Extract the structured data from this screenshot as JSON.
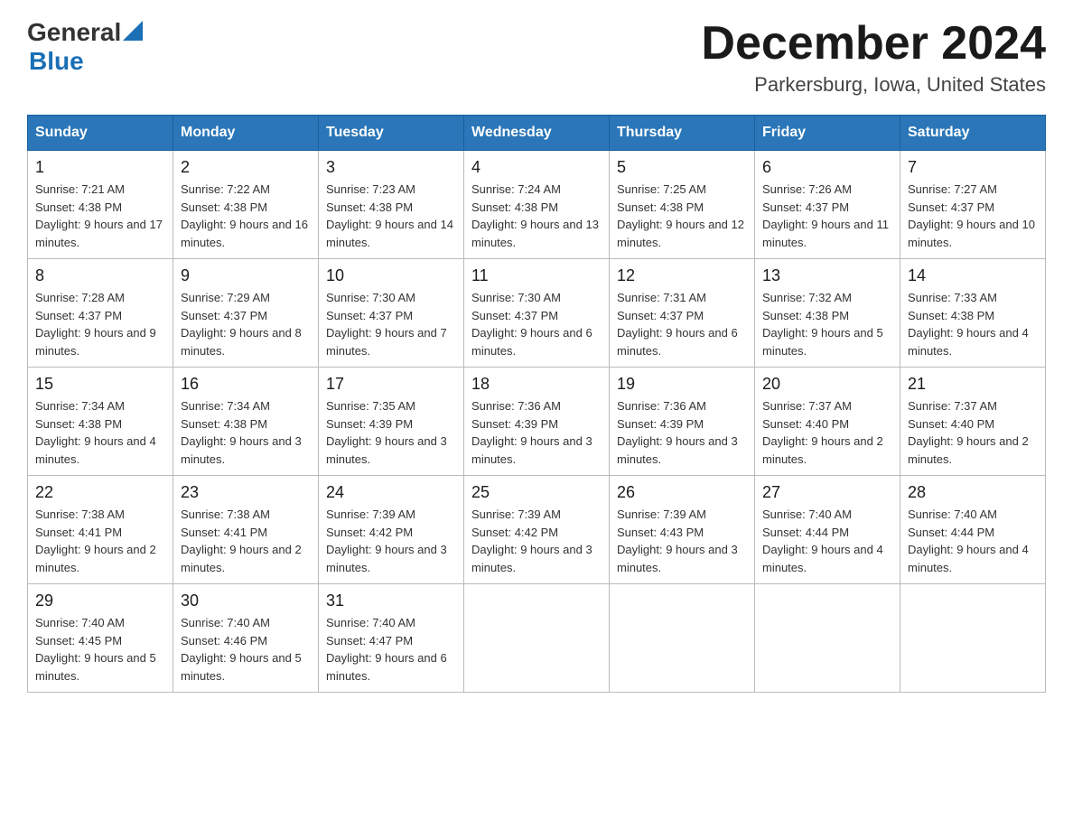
{
  "logo": {
    "general": "General",
    "blue": "Blue"
  },
  "header": {
    "month_title": "December 2024",
    "location": "Parkersburg, Iowa, United States"
  },
  "weekdays": [
    "Sunday",
    "Monday",
    "Tuesday",
    "Wednesday",
    "Thursday",
    "Friday",
    "Saturday"
  ],
  "weeks": [
    [
      {
        "day": "1",
        "sunrise": "7:21 AM",
        "sunset": "4:38 PM",
        "daylight": "9 hours and 17 minutes."
      },
      {
        "day": "2",
        "sunrise": "7:22 AM",
        "sunset": "4:38 PM",
        "daylight": "9 hours and 16 minutes."
      },
      {
        "day": "3",
        "sunrise": "7:23 AM",
        "sunset": "4:38 PM",
        "daylight": "9 hours and 14 minutes."
      },
      {
        "day": "4",
        "sunrise": "7:24 AM",
        "sunset": "4:38 PM",
        "daylight": "9 hours and 13 minutes."
      },
      {
        "day": "5",
        "sunrise": "7:25 AM",
        "sunset": "4:38 PM",
        "daylight": "9 hours and 12 minutes."
      },
      {
        "day": "6",
        "sunrise": "7:26 AM",
        "sunset": "4:37 PM",
        "daylight": "9 hours and 11 minutes."
      },
      {
        "day": "7",
        "sunrise": "7:27 AM",
        "sunset": "4:37 PM",
        "daylight": "9 hours and 10 minutes."
      }
    ],
    [
      {
        "day": "8",
        "sunrise": "7:28 AM",
        "sunset": "4:37 PM",
        "daylight": "9 hours and 9 minutes."
      },
      {
        "day": "9",
        "sunrise": "7:29 AM",
        "sunset": "4:37 PM",
        "daylight": "9 hours and 8 minutes."
      },
      {
        "day": "10",
        "sunrise": "7:30 AM",
        "sunset": "4:37 PM",
        "daylight": "9 hours and 7 minutes."
      },
      {
        "day": "11",
        "sunrise": "7:30 AM",
        "sunset": "4:37 PM",
        "daylight": "9 hours and 6 minutes."
      },
      {
        "day": "12",
        "sunrise": "7:31 AM",
        "sunset": "4:37 PM",
        "daylight": "9 hours and 6 minutes."
      },
      {
        "day": "13",
        "sunrise": "7:32 AM",
        "sunset": "4:38 PM",
        "daylight": "9 hours and 5 minutes."
      },
      {
        "day": "14",
        "sunrise": "7:33 AM",
        "sunset": "4:38 PM",
        "daylight": "9 hours and 4 minutes."
      }
    ],
    [
      {
        "day": "15",
        "sunrise": "7:34 AM",
        "sunset": "4:38 PM",
        "daylight": "9 hours and 4 minutes."
      },
      {
        "day": "16",
        "sunrise": "7:34 AM",
        "sunset": "4:38 PM",
        "daylight": "9 hours and 3 minutes."
      },
      {
        "day": "17",
        "sunrise": "7:35 AM",
        "sunset": "4:39 PM",
        "daylight": "9 hours and 3 minutes."
      },
      {
        "day": "18",
        "sunrise": "7:36 AM",
        "sunset": "4:39 PM",
        "daylight": "9 hours and 3 minutes."
      },
      {
        "day": "19",
        "sunrise": "7:36 AM",
        "sunset": "4:39 PM",
        "daylight": "9 hours and 3 minutes."
      },
      {
        "day": "20",
        "sunrise": "7:37 AM",
        "sunset": "4:40 PM",
        "daylight": "9 hours and 2 minutes."
      },
      {
        "day": "21",
        "sunrise": "7:37 AM",
        "sunset": "4:40 PM",
        "daylight": "9 hours and 2 minutes."
      }
    ],
    [
      {
        "day": "22",
        "sunrise": "7:38 AM",
        "sunset": "4:41 PM",
        "daylight": "9 hours and 2 minutes."
      },
      {
        "day": "23",
        "sunrise": "7:38 AM",
        "sunset": "4:41 PM",
        "daylight": "9 hours and 2 minutes."
      },
      {
        "day": "24",
        "sunrise": "7:39 AM",
        "sunset": "4:42 PM",
        "daylight": "9 hours and 3 minutes."
      },
      {
        "day": "25",
        "sunrise": "7:39 AM",
        "sunset": "4:42 PM",
        "daylight": "9 hours and 3 minutes."
      },
      {
        "day": "26",
        "sunrise": "7:39 AM",
        "sunset": "4:43 PM",
        "daylight": "9 hours and 3 minutes."
      },
      {
        "day": "27",
        "sunrise": "7:40 AM",
        "sunset": "4:44 PM",
        "daylight": "9 hours and 4 minutes."
      },
      {
        "day": "28",
        "sunrise": "7:40 AM",
        "sunset": "4:44 PM",
        "daylight": "9 hours and 4 minutes."
      }
    ],
    [
      {
        "day": "29",
        "sunrise": "7:40 AM",
        "sunset": "4:45 PM",
        "daylight": "9 hours and 5 minutes."
      },
      {
        "day": "30",
        "sunrise": "7:40 AM",
        "sunset": "4:46 PM",
        "daylight": "9 hours and 5 minutes."
      },
      {
        "day": "31",
        "sunrise": "7:40 AM",
        "sunset": "4:47 PM",
        "daylight": "9 hours and 6 minutes."
      },
      null,
      null,
      null,
      null
    ]
  ],
  "labels": {
    "sunrise": "Sunrise:",
    "sunset": "Sunset:",
    "daylight": "Daylight:"
  }
}
